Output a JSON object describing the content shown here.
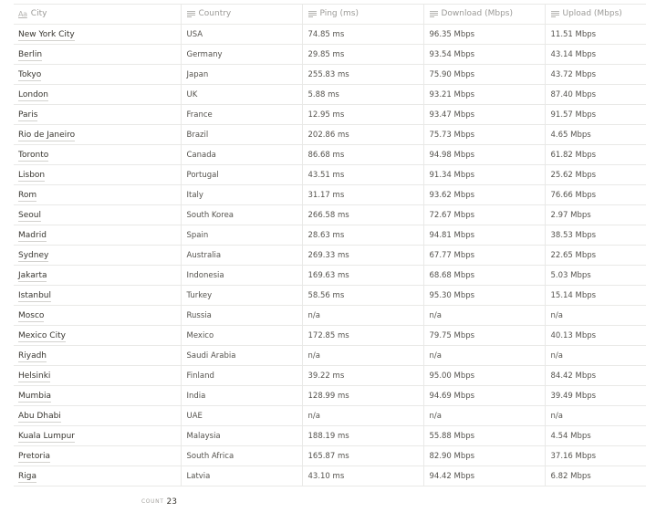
{
  "table": {
    "columns": [
      {
        "label": "City",
        "icon": "title-property-icon",
        "type": "title"
      },
      {
        "label": "Country",
        "icon": "text-property-icon",
        "type": "text"
      },
      {
        "label": "Ping (ms)",
        "icon": "text-property-icon",
        "type": "text"
      },
      {
        "label": "Download (Mbps)",
        "icon": "text-property-icon",
        "type": "text"
      },
      {
        "label": "Upload (Mbps)",
        "icon": "text-property-icon",
        "type": "text"
      }
    ],
    "title_icon_text": "Aa",
    "rows": [
      {
        "city": "New York City",
        "country": "USA",
        "ping": "74.85 ms",
        "download": "96.35 Mbps",
        "upload": "11.51 Mbps"
      },
      {
        "city": "Berlin",
        "country": "Germany",
        "ping": "29.85 ms",
        "download": "93.54 Mbps",
        "upload": "43.14 Mbps"
      },
      {
        "city": "Tokyo",
        "country": "Japan",
        "ping": "255.83 ms",
        "download": "75.90 Mbps",
        "upload": "43.72 Mbps"
      },
      {
        "city": "London",
        "country": "UK",
        "ping": "5.88 ms",
        "download": "93.21 Mbps",
        "upload": "87.40 Mbps"
      },
      {
        "city": "Paris",
        "country": "France",
        "ping": "12.95 ms",
        "download": "93.47 Mbps",
        "upload": "91.57 Mbps"
      },
      {
        "city": "Rio de Janeiro",
        "country": "Brazil",
        "ping": "202.86 ms",
        "download": "75.73 Mbps",
        "upload": "4.65 Mbps"
      },
      {
        "city": "Toronto",
        "country": "Canada",
        "ping": "86.68 ms",
        "download": "94.98 Mbps",
        "upload": "61.82 Mbps"
      },
      {
        "city": "Lisbon",
        "country": "Portugal",
        "ping": "43.51 ms",
        "download": "91.34 Mbps",
        "upload": "25.62 Mbps"
      },
      {
        "city": "Rom",
        "country": "Italy",
        "ping": "31.17 ms",
        "download": "93.62 Mbps",
        "upload": "76.66 Mbps"
      },
      {
        "city": "Seoul",
        "country": "South Korea",
        "ping": "266.58 ms",
        "download": "72.67 Mbps",
        "upload": "2.97 Mbps"
      },
      {
        "city": "Madrid",
        "country": "Spain",
        "ping": "28.63 ms",
        "download": "94.81 Mbps",
        "upload": "38.53 Mbps"
      },
      {
        "city": "Sydney",
        "country": "Australia",
        "ping": "269.33 ms",
        "download": "67.77 Mbps",
        "upload": "22.65 Mbps"
      },
      {
        "city": "Jakarta",
        "country": "Indonesia",
        "ping": "169.63 ms",
        "download": "68.68 Mbps",
        "upload": "5.03 Mbps"
      },
      {
        "city": "Istanbul",
        "country": "Turkey",
        "ping": "58.56 ms",
        "download": "95.30 Mbps",
        "upload": "15.14 Mbps"
      },
      {
        "city": "Mosco",
        "country": "Russia",
        "ping": "n/a",
        "download": "n/a",
        "upload": "n/a"
      },
      {
        "city": "Mexico City",
        "country": "Mexico",
        "ping": "172.85 ms",
        "download": "79.75 Mbps",
        "upload": "40.13 Mbps"
      },
      {
        "city": "Riyadh",
        "country": "Saudi Arabia",
        "ping": "n/a",
        "download": "n/a",
        "upload": "n/a"
      },
      {
        "city": "Helsinki",
        "country": "Finland",
        "ping": "39.22 ms",
        "download": "95.00 Mbps",
        "upload": "84.42 Mbps"
      },
      {
        "city": "Mumbia",
        "country": "India",
        "ping": "128.99 ms",
        "download": "94.69 Mbps",
        "upload": "39.49 Mbps"
      },
      {
        "city": "Abu Dhabi",
        "country": "UAE",
        "ping": "n/a",
        "download": "n/a",
        "upload": "n/a"
      },
      {
        "city": "Kuala Lumpur",
        "country": "Malaysia",
        "ping": "188.19 ms",
        "download": "55.88 Mbps",
        "upload": "4.54 Mbps"
      },
      {
        "city": "Pretoria",
        "country": "South Africa",
        "ping": "165.87 ms",
        "download": "82.90 Mbps",
        "upload": "37.16 Mbps"
      },
      {
        "city": "Riga",
        "country": "Latvia",
        "ping": "43.10 ms",
        "download": "94.42 Mbps",
        "upload": "6.82 Mbps"
      }
    ]
  },
  "footer": {
    "count_label": "COUNT",
    "count_value": "23"
  }
}
